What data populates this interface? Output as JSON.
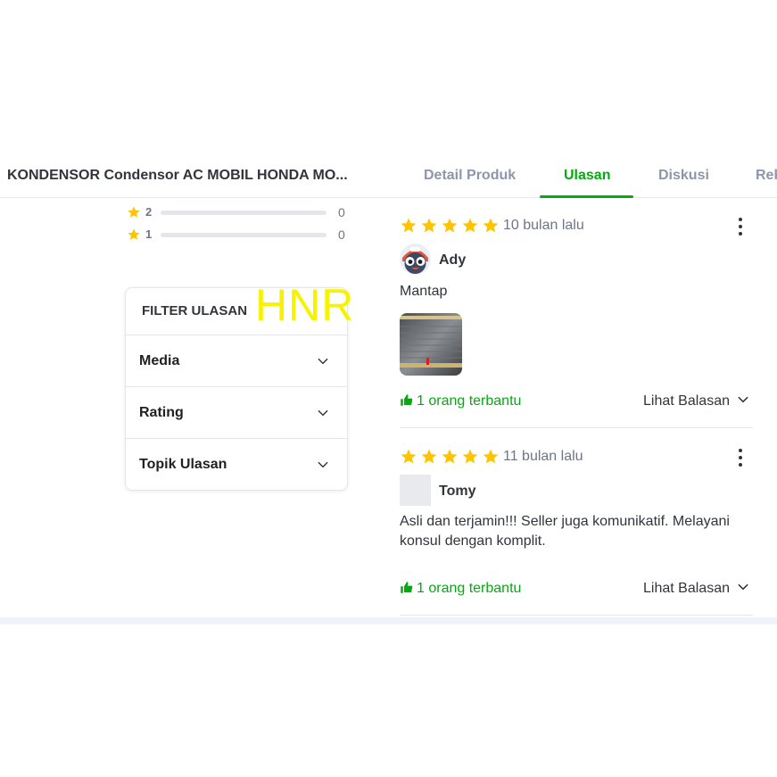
{
  "header": {
    "product_title": "KONDENSOR Condensor AC MOBIL HONDA MO...",
    "tabs": [
      {
        "label": "Detail Produk",
        "active": false
      },
      {
        "label": "Ulasan",
        "active": true
      },
      {
        "label": "Diskusi",
        "active": false
      },
      {
        "label": "Rek",
        "active": false
      }
    ],
    "accent_color": "#03ac0e"
  },
  "rating_breakdown": [
    {
      "stars": "2",
      "count": "0",
      "fraction": 0
    },
    {
      "stars": "1",
      "count": "0",
      "fraction": 0
    }
  ],
  "filter": {
    "title": "FILTER ULASAN",
    "items": [
      {
        "label": "Media",
        "icon": "chevron-down-icon"
      },
      {
        "label": "Rating",
        "icon": "chevron-down-icon"
      },
      {
        "label": "Topik Ulasan",
        "icon": "chevron-down-icon"
      }
    ]
  },
  "watermark": "HNR",
  "reviews": [
    {
      "rating": 5,
      "time": "10 bulan lalu",
      "user": "Ady",
      "avatar": "cartoon-avatar",
      "text": "Mantap",
      "has_image": true,
      "helpful": "1 orang terbantu",
      "reply_label": "Lihat Balasan"
    },
    {
      "rating": 5,
      "time": "11 bulan lalu",
      "user": "Tomy",
      "avatar": "blank-avatar",
      "text": "Asli dan terjamin!!! Seller juga komunikatif. Melayani konsul dengan komplit.",
      "has_image": false,
      "helpful": "1 orang terbantu",
      "reply_label": "Lihat Balasan"
    }
  ],
  "star_color": "#ffc400"
}
